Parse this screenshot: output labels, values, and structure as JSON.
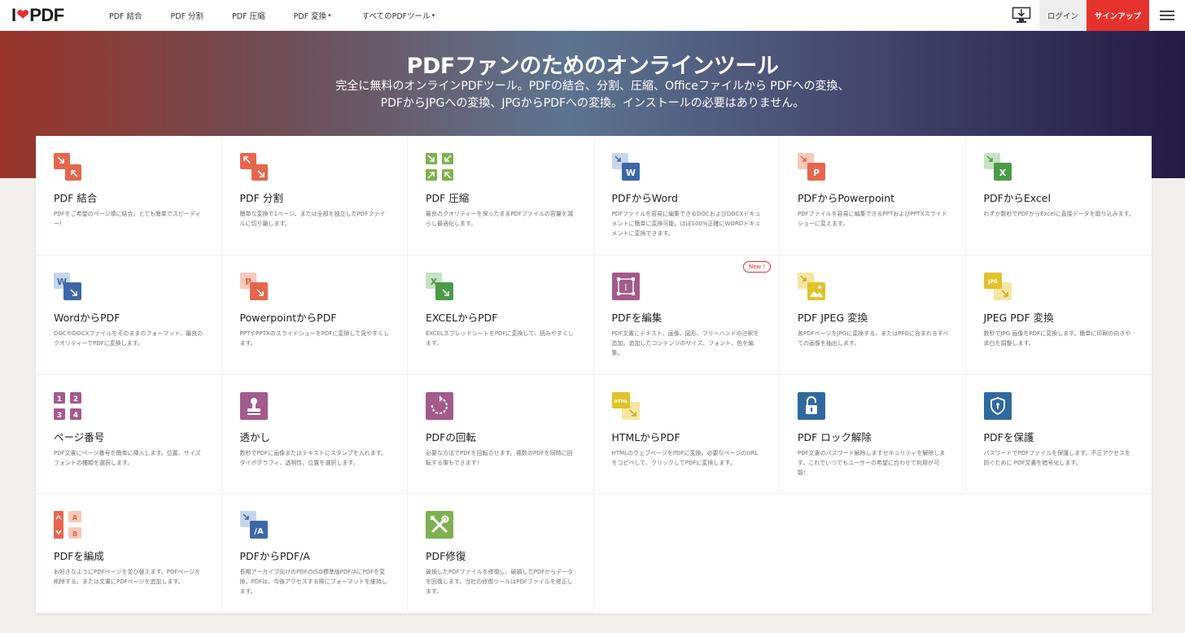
{
  "nav": {
    "logo_left": "I",
    "logo_right": "PDF",
    "links": [
      {
        "label": "PDF 結合",
        "caret": ""
      },
      {
        "label": "PDF 分割",
        "caret": ""
      },
      {
        "label": "PDF 圧縮",
        "caret": ""
      },
      {
        "label": "PDF 変換",
        "caret": "▾"
      },
      {
        "label": "すべてのPDFツール",
        "caret": "▾"
      }
    ],
    "login": "ログイン",
    "signup": "サインアップ"
  },
  "hero": {
    "title": "PDFファンのためのオンラインツール",
    "line1": "完全に無料のオンラインPDFツール。PDFの結合、分割、圧縮、Officeファイルから PDFへの変換、",
    "line2": "PDFからJPGへの変換、JPGからPDFへの変換。インストールの必要はありません。"
  },
  "badge": "New !",
  "tools": [
    {
      "title": "PDF 結合",
      "desc": "PDFをご希望のページ順に結合。とても簡単でスピーディー！",
      "icon": "merge-icon"
    },
    {
      "title": "PDF 分割",
      "desc": "簡単な変換で1ページ、または全部を独立したPDFファイルに切り離します。",
      "icon": "split-icon"
    },
    {
      "title": "PDF 圧縮",
      "desc": "最良のクオリティーを保ったままPDFファイルの容量を減らし最適化します。",
      "icon": "compress-icon"
    },
    {
      "title": "PDFからWord",
      "desc": "PDFファイルを容易に編集できるDOCおよびDOCXドキュメントに簡単に変換可能。ほぼ100%正確にWORDドキュメントに変換できます。",
      "icon": "pdf-to-word-icon"
    },
    {
      "title": "PDFからPowerpoint",
      "desc": "PDFファイルを容易に編集できるPPTおよびPPTXスライドショーに変えます。",
      "icon": "pdf-to-powerpoint-icon"
    },
    {
      "title": "PDFからExcel",
      "desc": "わずか数秒でPDFからExcelに直接データを取り込みます。",
      "icon": "pdf-to-excel-icon"
    },
    {
      "title": "WordからPDF",
      "desc": "DOCやDOCXファイルをそのままのフォーマット、最良のクオリティーでPDFに変換します。",
      "icon": "word-to-pdf-icon"
    },
    {
      "title": "PowerpointからPDF",
      "desc": "PPTやPPTXのスライドショーをPDFに変換して見やすくします。",
      "icon": "powerpoint-to-pdf-icon"
    },
    {
      "title": "EXCELからPDF",
      "desc": "EXCELスプレッドシートをPDFに変換して、読みやすくします。",
      "icon": "excel-to-pdf-icon"
    },
    {
      "title": "PDFを編集",
      "desc": "PDF文書にテキスト、画像、図形、フリーハンドの注釈を追加。追加したコンテンツのサイズ、フォント、色を編集。",
      "icon": "edit-pdf-icon"
    },
    {
      "title": "PDF JPEG 変換",
      "desc": "各PDFページをJPGに変換する、またはPFDに含まれるすべての画像を抽出します。",
      "icon": "pdf-to-jpg-icon"
    },
    {
      "title": "JPEG PDF 変換",
      "desc": "数秒でJPG 画像をPDFに変換します。簡単に印刷の向きや余白を調整します。",
      "icon": "jpg-to-pdf-icon"
    },
    {
      "title": "ページ番号",
      "desc": "PDF文書にページ番号を簡単に挿入します。位置、サイズフォントの種類を選択します。",
      "icon": "page-numbers-icon"
    },
    {
      "title": "透かし",
      "desc": "数秒でPDFに画像またはテキストにスタンプを入れます。タイポグラフィ、透明性、位置を選択します。",
      "icon": "watermark-icon"
    },
    {
      "title": "PDFの回転",
      "desc": "必要な方法でPDFを回転させます。複数のPDFを同時に回転する事もできます！",
      "icon": "rotate-icon"
    },
    {
      "title": "HTMLからPDF",
      "desc": "HTMLのウェブページをPDFに変換。必要なページのURLをコピペして、クリックしてPDFに変換します。",
      "icon": "html-to-pdf-icon"
    },
    {
      "title": "PDF ロック解除",
      "desc": "PDF文書のパスワード解除しますセキュリティを解除します。これでいつでもユーザーの希望に合わせて利用が可能！",
      "icon": "unlock-icon"
    },
    {
      "title": "PDFを保護",
      "desc": "パスワードでPDFファイルを保護します。不正アクセスを防ぐために PDF文書を暗号化します。",
      "icon": "protect-icon"
    },
    {
      "title": "PDFを編成",
      "desc": "お好きなようにPDFページを並び替えます。PDFページを削除する、または文書にPDFページを追加します。",
      "icon": "organize-icon"
    },
    {
      "title": "PDFからPDF/A",
      "desc": "長期アーカイブ向けのPDFのISO標準版PDF/AにPDFを変換。PDFは、今後アクセスする際にフォーマットを維持します。",
      "icon": "pdf-to-pdfa-icon"
    },
    {
      "title": "PDF修復",
      "desc": "破損したPDFファイルを修復し、破損したPDFからデータを回復します。当社の修復ツールはPDFファイルを修正します。",
      "icon": "repair-icon"
    }
  ],
  "colors": {
    "brand": "#e5322d",
    "merge": "#e5664e",
    "compress": "#7fb04f",
    "word": "#3e67a8",
    "excel": "#4c9a47",
    "edit": "#a35a8c",
    "jpg": "#e1c32c",
    "unlock": "#2f6a9c"
  }
}
